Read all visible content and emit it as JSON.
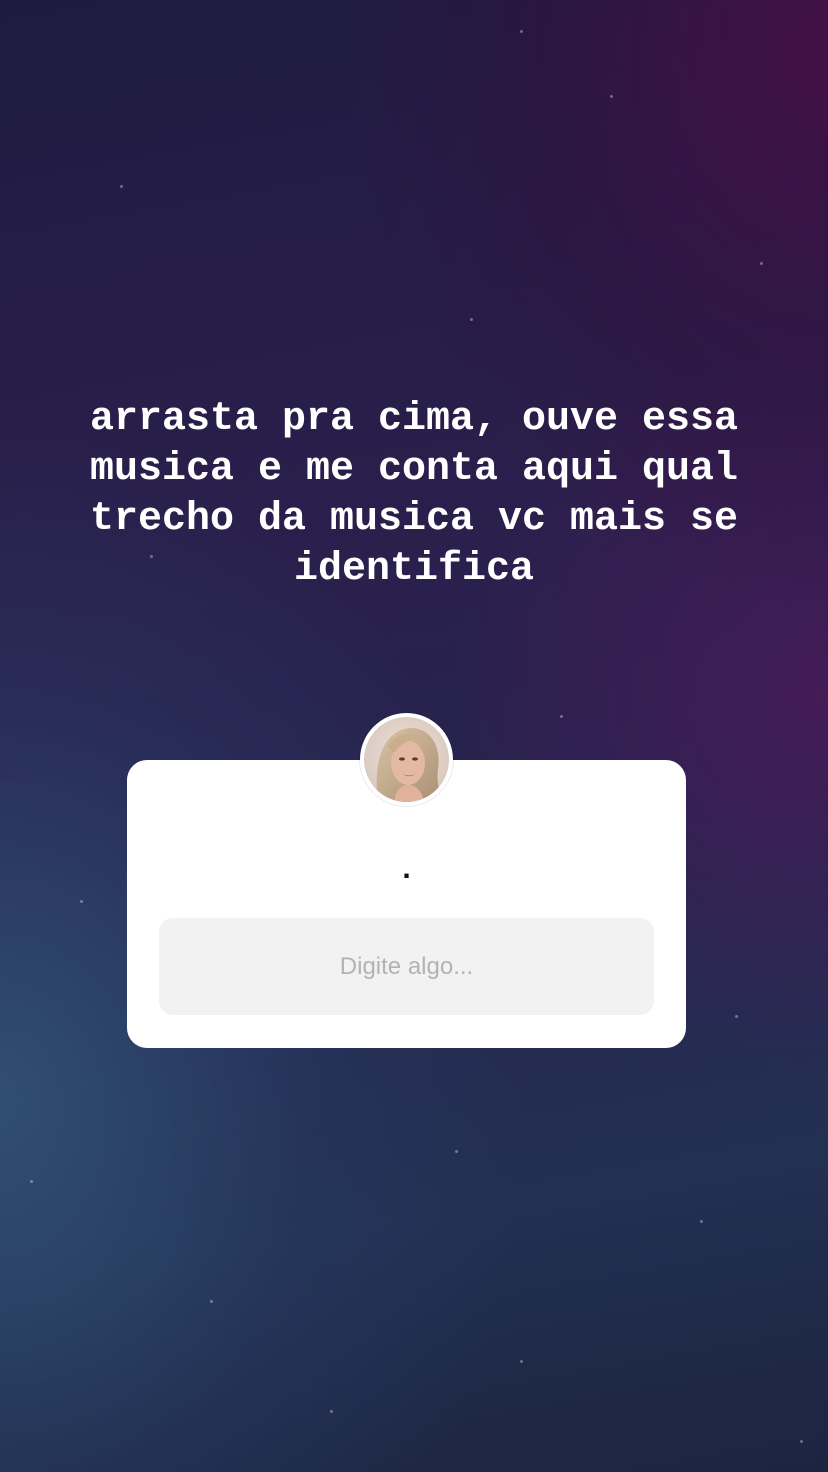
{
  "story": {
    "caption": "arrasta pra cima, ouve essa musica e me conta aqui qual trecho da musica vc mais se identifica"
  },
  "question_sticker": {
    "prompt": ".",
    "answer_placeholder": "Digite algo...",
    "avatar_icon": "profile-avatar"
  },
  "colors": {
    "background_top_right": "#3a1040",
    "background_mid": "#27234f",
    "background_bottom_left": "#2f4a6a",
    "text": "#ffffff",
    "card": "#ffffff",
    "input_bg": "#f2f2f2",
    "placeholder": "#b3b3b3"
  }
}
